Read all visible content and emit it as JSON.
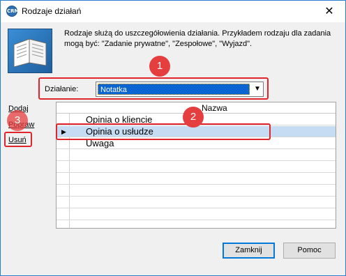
{
  "window": {
    "title": "Rodzaje działań",
    "icon_text": "CRM",
    "close_glyph": "✕"
  },
  "header": {
    "image_name": "open-book-image",
    "description": "Rodzaje służą do uszczegółowienia działania. Przykładem rodzaju dla zadania mogą być: \"Zadanie prywatne\", \"Zespołowe\", \"Wyjazd\"."
  },
  "filter": {
    "label": "Działanie:",
    "selected_value": "Notatka",
    "arrow_glyph": "▼"
  },
  "actions": {
    "add": "Dodaj",
    "edit": "Popraw",
    "delete": "Usuń"
  },
  "grid": {
    "column_header": "Nazwa",
    "rows": [
      "Opinia o kliencie",
      "Opinia o usłudze",
      "Uwaga"
    ],
    "selected_index": 1,
    "pointer_glyph": "▶"
  },
  "footer": {
    "close_label": "Zamknij",
    "help_label": "Pomoc"
  },
  "annotations": {
    "badge_1": "1",
    "badge_2": "2",
    "badge_3": "3"
  },
  "colors": {
    "callout": "#e0252b",
    "selection": "#0a64d2",
    "selected_row": "#c5dcf3"
  }
}
